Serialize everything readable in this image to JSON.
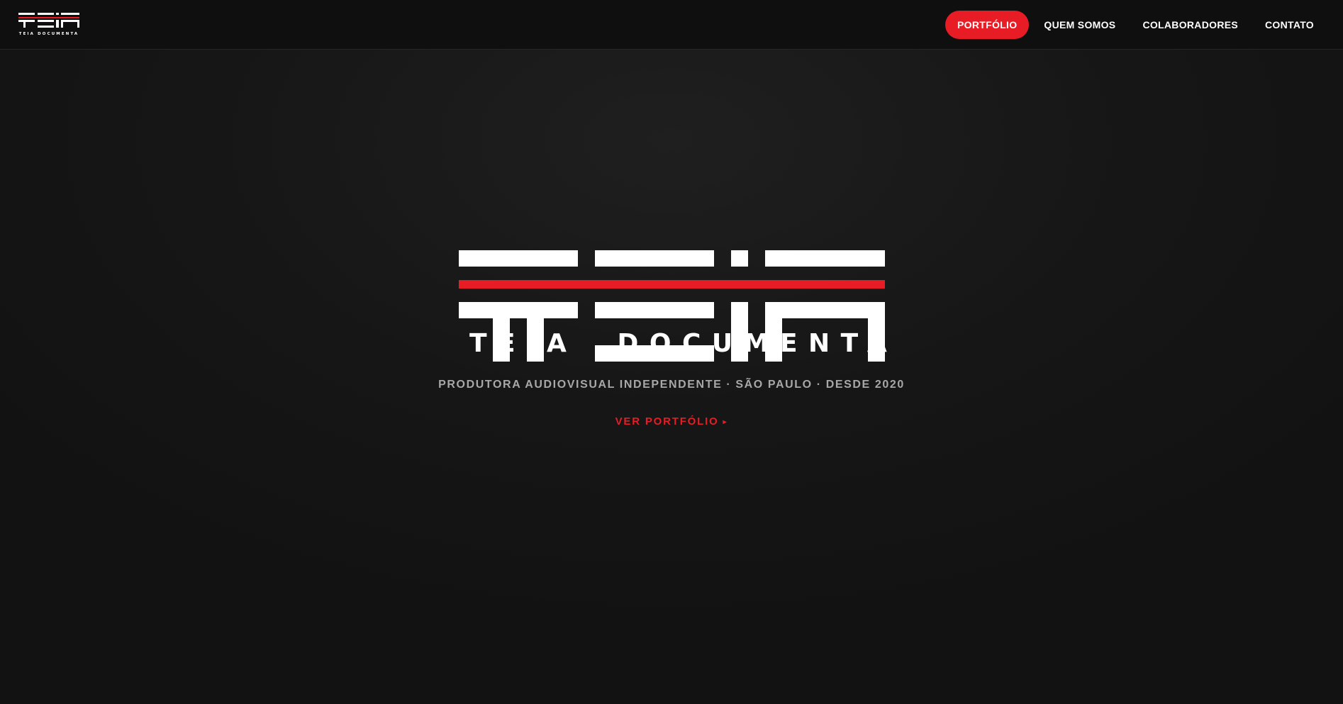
{
  "brand": {
    "logo_icon": "teia-logo-icon",
    "logo_caption": "TEIA DOCUMENTA",
    "name_word1": "TEIA",
    "name_word2": "DOCUMENTA"
  },
  "nav": {
    "items": [
      {
        "label": "PORTFÓLIO",
        "active": true
      },
      {
        "label": "QUEM SOMOS",
        "active": false
      },
      {
        "label": "COLABORADORES",
        "active": false
      },
      {
        "label": "CONTATO",
        "active": false
      }
    ]
  },
  "hero": {
    "tagline": "PRODUTORA AUDIOVISUAL INDEPENDENTE · SÃO PAULO · DESDE 2020",
    "cta_label": "VER PORTFÓLIO",
    "cta_icon": "play-arrow-icon",
    "cta_arrow": "▸"
  },
  "colors": {
    "accent": "#e81c24",
    "background": "#141414",
    "navbar": "#0f0f0f",
    "text": "#ffffff",
    "muted_text": "#a8a8a8"
  }
}
